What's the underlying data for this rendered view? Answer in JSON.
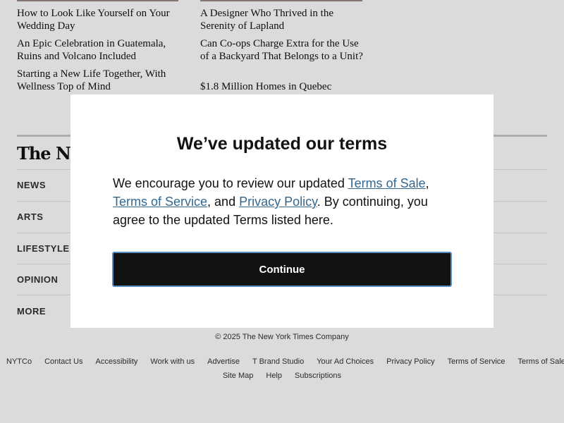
{
  "articles": {
    "col1": [
      "How to Look Like Yourself on Your Wedding Day",
      "An Epic Celebration in Guatemala, Ruins and Volcano Included",
      "Starting a New Life Together, With Wellness Top of Mind"
    ],
    "col2": [
      "A Designer Who Thrived in the Serenity of Lapland",
      "Can Co-ops Charge Extra for the Use of a Backyard That Belongs to a Unit?",
      "$1.8 Million Homes in Quebec"
    ]
  },
  "footer": {
    "logo": "The New York Times",
    "sections": [
      "NEWS",
      "ARTS",
      "LIFESTYLE",
      "OPINION",
      "MORE"
    ],
    "copyright": "© 2025 The New York Times Company",
    "links_row1": [
      "NYTCo",
      "Contact Us",
      "Accessibility",
      "Work with us",
      "Advertise",
      "T Brand Studio",
      "Your Ad Choices",
      "Privacy Policy",
      "Terms of Service",
      "Terms of Sale"
    ],
    "links_row2": [
      "Site Map",
      "Help",
      "Subscriptions"
    ]
  },
  "modal": {
    "title": "We’ve updated our terms",
    "body_prefix": "We encourage you to review our updated ",
    "link_terms_sale": "Terms of Sale",
    "sep1": ", ",
    "link_terms_service": "Terms of Service",
    "sep2": ", and ",
    "link_privacy": "Privacy Policy",
    "body_suffix": ". By continuing, you agree to the updated Terms listed here.",
    "continue_label": "Continue"
  },
  "colors": {
    "link": "#326891",
    "button_bg": "#121212",
    "button_border": "#5b8ec4"
  }
}
